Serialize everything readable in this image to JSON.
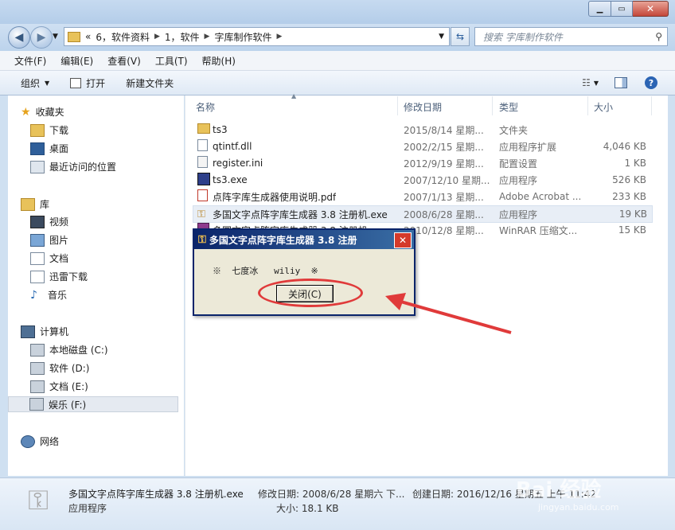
{
  "address": {
    "segments": [
      "«",
      "6，软件资料",
      "1，软件",
      "字库制作软件"
    ]
  },
  "search": {
    "placeholder": "搜索 字库制作软件"
  },
  "menu": [
    "文件(F)",
    "编辑(E)",
    "查看(V)",
    "工具(T)",
    "帮助(H)"
  ],
  "toolbar": {
    "organize": "组织",
    "open": "打开",
    "new_folder": "新建文件夹"
  },
  "nav": {
    "favorites": "收藏夹",
    "fav_items": [
      "下载",
      "桌面",
      "最近访问的位置"
    ],
    "libraries": "库",
    "lib_items": [
      "视频",
      "图片",
      "文档",
      "迅雷下载",
      "音乐"
    ],
    "computer": "计算机",
    "drives": [
      "本地磁盘 (C:)",
      "软件 (D:)",
      "文档 (E:)",
      "娱乐 (F:)"
    ],
    "network": "网络"
  },
  "columns": {
    "name": "名称",
    "date": "修改日期",
    "type": "类型",
    "size": "大小"
  },
  "files": [
    {
      "name": "ts3",
      "date": "2015/8/14 星期...",
      "type": "文件夹",
      "size": ""
    },
    {
      "name": "qtintf.dll",
      "date": "2002/2/15 星期...",
      "type": "应用程序扩展",
      "size": "4,046 KB"
    },
    {
      "name": "register.ini",
      "date": "2012/9/19 星期...",
      "type": "配置设置",
      "size": "1 KB"
    },
    {
      "name": "ts3.exe",
      "date": "2007/12/10 星期...",
      "type": "应用程序",
      "size": "526 KB"
    },
    {
      "name": "点阵字库生成器使用说明.pdf",
      "date": "2007/1/13 星期...",
      "type": "Adobe Acrobat ...",
      "size": "233 KB"
    },
    {
      "name": "多国文字点阵字库生成器 3.8 注册机.exe",
      "date": "2008/6/28 星期...",
      "type": "应用程序",
      "size": "19 KB"
    },
    {
      "name": "多国文字点阵字库生成器 3.8 注册机...",
      "date": "2010/12/8 星期...",
      "type": "WinRAR 压缩文...",
      "size": "15 KB"
    }
  ],
  "details": {
    "filename": "多国文字点阵字库生成器 3.8 注册机.exe",
    "modified": "修改日期: 2008/6/28 星期六 下...",
    "created": "创建日期: 2016/12/16 星期五 上午 11:42",
    "kind": "应用程序",
    "size": "大小: 18.1 KB"
  },
  "dialog": {
    "title": "多国文字点阵字库生成器 3.8 注册",
    "message": "※  七度冰   wiliy  ※",
    "close_button": "关闭(C)"
  },
  "watermark": {
    "line1": "Bai 经验",
    "line2": "jingyan.baidu.com"
  },
  "colors": {
    "annotation": "#e03a3a",
    "dialog_title": "#0a246a"
  }
}
